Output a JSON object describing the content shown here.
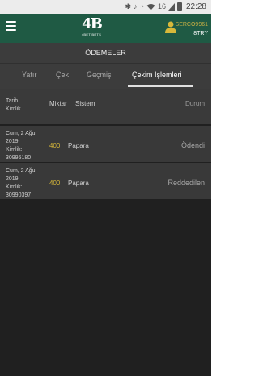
{
  "status_bar": {
    "network": "16",
    "time": "22:28"
  },
  "header": {
    "logo_mark": "4B",
    "logo_sub": "4BET BETS",
    "username": "SERCO9961",
    "balance": "8TRY"
  },
  "page": {
    "title": "ÖDEMELER",
    "tabs": [
      {
        "label": "Yatır"
      },
      {
        "label": "Çek"
      },
      {
        "label": "Geçmiş"
      },
      {
        "label": "Çekim İşlemleri",
        "active": true
      }
    ]
  },
  "table": {
    "headers": {
      "date": "Tarih",
      "id": "Kimlik",
      "amount": "Miktar",
      "system": "Sistem",
      "status": "Durum"
    },
    "rows": [
      {
        "date_line1": "Cum, 2 Ağu",
        "date_line2": "2019",
        "id_line": "Kimlik:",
        "id_value": "30995180",
        "amount": "400",
        "system": "Papara",
        "status": "Ödendi"
      },
      {
        "date_line1": "Cum, 2 Ağu",
        "date_line2": "2019",
        "id_line": "Kimlik:",
        "id_value": "30990397",
        "amount": "400",
        "system": "Papara",
        "status": "Reddedilen"
      }
    ]
  },
  "colors": {
    "header_bg": "#1f5a44",
    "accent_gold": "#d7b83a",
    "screen_bg": "#202020"
  },
  "icons": [
    "menu-icon",
    "wifi-icon",
    "signal-icon",
    "battery-icon",
    "user-icon"
  ]
}
